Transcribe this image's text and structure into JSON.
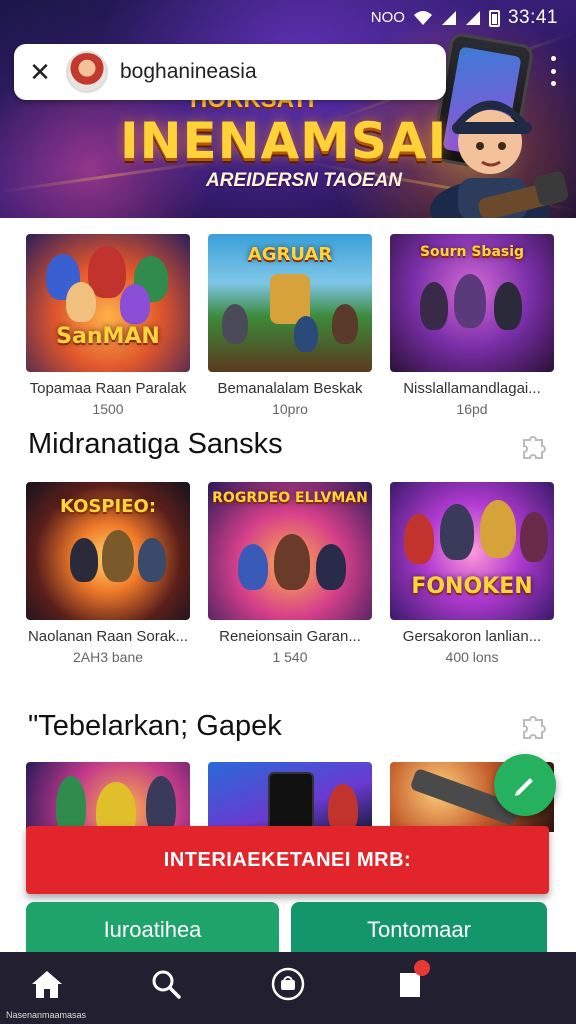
{
  "status_bar": {
    "network_text": "NOO",
    "time": "33:41"
  },
  "browser": {
    "url": "boghanineasia",
    "close_icon": "close-icon",
    "menu_icon": "more-vert-icon"
  },
  "hero": {
    "pretitle": "HORKSAYI",
    "title": "INENAMSAI",
    "subtitle": "AREIDERSN TAOEAN"
  },
  "section1": {
    "cards": [
      {
        "title": "Topamaa Raan Paralak",
        "meta": "1500",
        "thumb_label": "SanMAN"
      },
      {
        "title": "Bemanalalam Beskak",
        "meta": "10pro",
        "thumb_label": "AGRUAR"
      },
      {
        "title": "Nisslallamandlagai...",
        "meta": "16pd",
        "thumb_label": "Sourn Sbasig"
      }
    ]
  },
  "section2": {
    "title": "Midranatiga Sansks",
    "cards": [
      {
        "title": "Naolanan Raan Sorak...",
        "meta": "2AH3 bane",
        "thumb_label": "KOSPIEO:"
      },
      {
        "title": "Reneionsain Garan...",
        "meta": "1 540",
        "thumb_label": "ROGRDEO ELLVMAN"
      },
      {
        "title": "Gersakoron lanlian...",
        "meta": "400 lons",
        "thumb_label": "FONOKEN"
      }
    ]
  },
  "section3": {
    "title": "\"Tebelarkan; Gapek"
  },
  "cta": {
    "label": "INTERIAEKETANEI MRB:"
  },
  "buttons": {
    "left_label": "Iuroatihea",
    "right_label": "Tontomaar"
  },
  "bottom_nav": {
    "home_label": "Nasenanmaamasas",
    "icons": [
      "home-icon",
      "search-icon",
      "store-icon",
      "notification-icon"
    ]
  },
  "colors": {
    "cta_red": "#e2242b",
    "green": "#1ea36a",
    "fab_green": "#25b15e",
    "nav_bg": "#222030"
  }
}
